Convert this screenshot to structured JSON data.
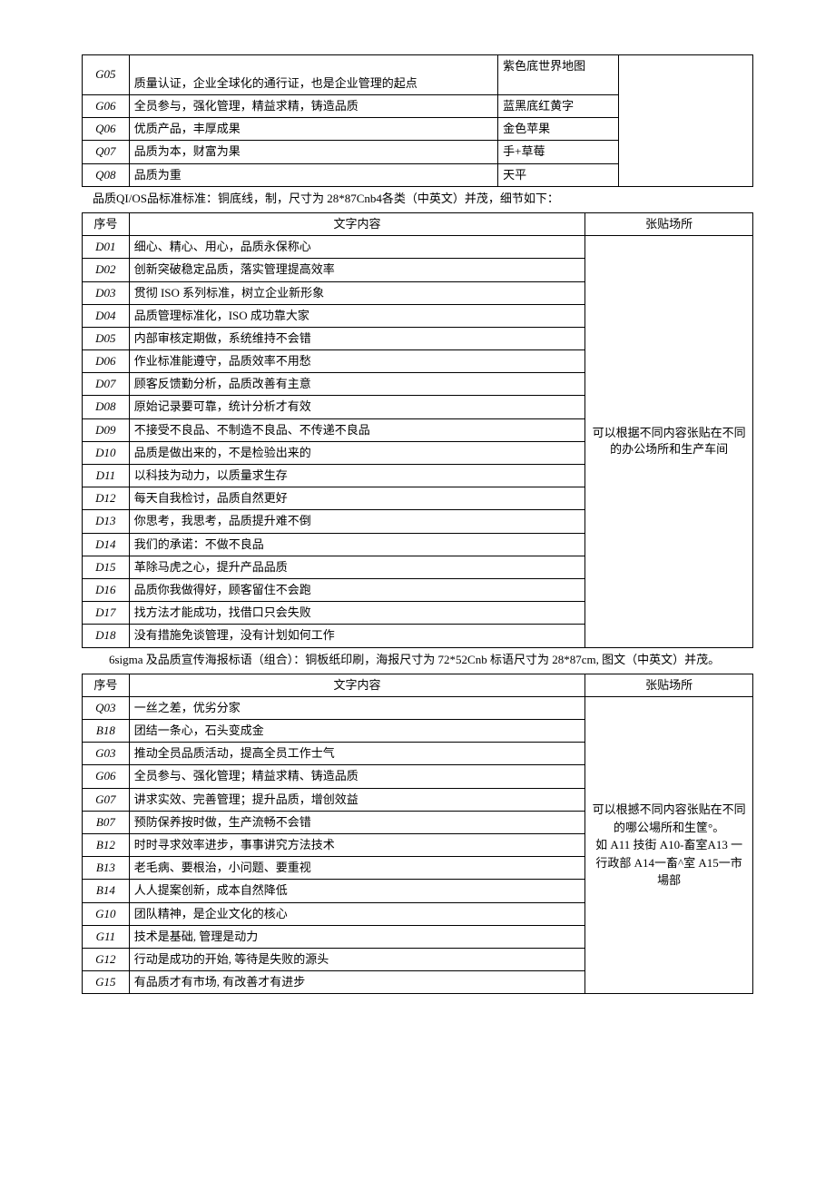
{
  "table1": {
    "rows": [
      {
        "id": "G05",
        "content": "质量认证，企业全球化的通行证，也是企业管理的起点",
        "extra": "紫色底世界地图"
      },
      {
        "id": "G06",
        "content": "全员参与，强化管理，精益求精，铸造品质",
        "extra": "蓝黑底红黄字"
      },
      {
        "id": "Q06",
        "content": "优质产品，丰厚成果",
        "extra": "金色苹果"
      },
      {
        "id": "Q07",
        "content": "品质为本，财富为果",
        "extra": "手+草莓"
      },
      {
        "id": "Q08",
        "content": "品质为重",
        "extra": "天平"
      }
    ]
  },
  "intertext1": "品质QI/OS品标准标准：铜底线，制，尺寸为 28*87Cnb4各类（中英文）并茂，细节如下：",
  "table2": {
    "header": {
      "id": "序号",
      "content": "文字内容",
      "note": "张贴场所"
    },
    "note": "可以根据不同内容张贴在不同的办公场所和生产车间",
    "rows": [
      {
        "id": "D01",
        "content": "细心、精心、用心，品质永保称心"
      },
      {
        "id": "D02",
        "content": "创新突破稳定品质，落实管理提高效率"
      },
      {
        "id": "D03",
        "content": "贯彻 ISO 系列标准，树立企业新形象"
      },
      {
        "id": "D04",
        "content": "品质管理标准化，ISO 成功靠大家"
      },
      {
        "id": "D05",
        "content": "内部审核定期做，系统维持不会错"
      },
      {
        "id": "D06",
        "content": "作业标准能遵守，品质效率不用愁"
      },
      {
        "id": "D07",
        "content": "顾客反馈勤分析，品质改善有主意"
      },
      {
        "id": "D08",
        "content": "原始记录要可靠，统计分析才有效"
      },
      {
        "id": "D09",
        "content": "不接受不良品、不制造不良品、不传递不良品"
      },
      {
        "id": "D10",
        "content": "品质是做出来的，不是检验出来的"
      },
      {
        "id": "D11",
        "content": "以科技为动力，以质量求生存"
      },
      {
        "id": "D12",
        "content": "每天自我检讨，品质自然更好"
      },
      {
        "id": "D13",
        "content": "你思考，我思考，品质提升难不倒"
      },
      {
        "id": "D14",
        "content": "我们的承诺：不做不良品"
      },
      {
        "id": "D15",
        "content": "革除马虎之心，提升产品品质"
      },
      {
        "id": "D16",
        "content": "品质你我做得好，顾客留住不会跑"
      },
      {
        "id": "D17",
        "content": "找方法才能成功，找借口只会失败"
      },
      {
        "id": "D18",
        "content": "没有措施免谈管理，没有计划如何工作"
      }
    ]
  },
  "intertext2": "6sigma 及品质宣传海报标语（组合）：铜板纸印刷，海报尺寸为 72*52Cnb 标语尺寸为 28*87cm, 图文（中英文）并茂。",
  "table3": {
    "header": {
      "id": "序号",
      "content": "文字内容",
      "note": "张贴场所"
    },
    "note": "可以根撼不同内容张贴在不同的哪公場所和生筐°。\n如 A11 技街 A10-畜室A13 一行政部 A14一畜^室 A15一市場部",
    "rows": [
      {
        "id": "Q03",
        "content": "一丝之差，优劣分家"
      },
      {
        "id": "B18",
        "content": "团结一条心，石头变成金"
      },
      {
        "id": "G03",
        "content": "推动全员品质活动，提高全员工作士气"
      },
      {
        "id": "G06",
        "content": "全员参与、强化管理；精益求精、铸造品质"
      },
      {
        "id": "G07",
        "content": "讲求实效、完善管理；提升品质，增创效益"
      },
      {
        "id": "B07",
        "content": "预防保养按时做，生产流畅不会错"
      },
      {
        "id": "B12",
        "content": "时时寻求效率进步，事事讲究方法技术"
      },
      {
        "id": "B13",
        "content": "老毛病、要根治，小问题、要重视"
      },
      {
        "id": "B14",
        "content": "人人提案创新，成本自然降低"
      },
      {
        "id": "G10",
        "content": "团队精神，是企业文化的核心"
      },
      {
        "id": "G11",
        "content": "技术是基础, 管理是动力"
      },
      {
        "id": "G12",
        "content": "行动是成功的开始, 等待是失败的源头"
      },
      {
        "id": "G15",
        "content": "有品质才有市场, 有改善才有进步"
      }
    ]
  }
}
